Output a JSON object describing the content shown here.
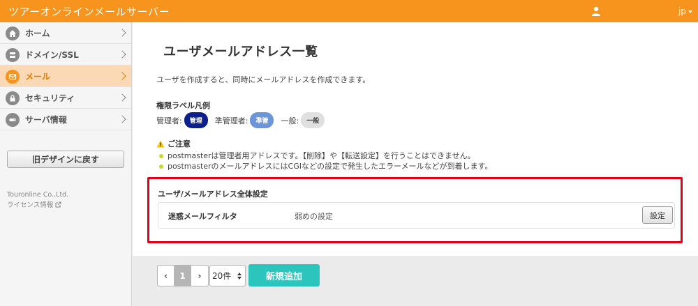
{
  "header": {
    "app_title": "ツアーオンラインメールサーバー",
    "lang_label": "jp"
  },
  "sidebar": {
    "items": [
      {
        "label": "ホーム",
        "icon": "home-icon",
        "active": false
      },
      {
        "label": "ドメイン/SSL",
        "icon": "server-icon",
        "active": false
      },
      {
        "label": "メール",
        "icon": "mail-icon",
        "active": true
      },
      {
        "label": "セキュリティ",
        "icon": "lock-icon",
        "active": false
      },
      {
        "label": "サーバ情報",
        "icon": "hdd-icon",
        "active": false
      }
    ],
    "old_design_label": "旧デザインに戻す",
    "company": "Touronline Co.,Ltd.",
    "license_label": "ライセンス情報"
  },
  "main": {
    "title": "ユーザメールアドレス一覧",
    "intro": "ユーザを作成すると、同時にメールアドレスを作成できます。",
    "legend": {
      "title": "権限ラベル凡例",
      "admin_prefix": "管理者:",
      "admin_badge": "管理",
      "sub_prefix": "準管理者:",
      "sub_badge": "準管",
      "general_prefix": "一般:",
      "general_badge": "一般"
    },
    "notice": {
      "title": "ご注意",
      "lines": [
        "postmasterは管理者用アドレスです。【削除】や【転送設定】を行うことはできません。",
        "postmasterのメールアドレスにはCGIなどの設定で発生したエラーメールなどが到着します。"
      ]
    },
    "global_settings": {
      "title": "ユーザ/メールアドレス全体設定",
      "row_label": "迷惑メールフィルタ",
      "row_value": "弱めの設定",
      "button_label": "設定"
    }
  },
  "footer": {
    "pager": {
      "prev": "‹",
      "current": "1",
      "next": "›"
    },
    "per_page": "20件",
    "add_button": "新規追加"
  },
  "colors": {
    "brand": "#f7941d",
    "highlight_border": "#e0001a",
    "add_button": "#2bc5bd",
    "admin_badge": "#0d1f8a",
    "sub_badge": "#6c96d8"
  }
}
